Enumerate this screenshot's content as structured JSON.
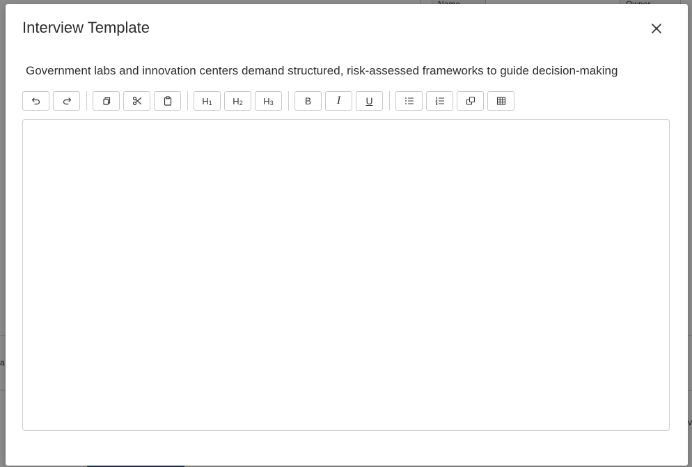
{
  "background": {
    "header_cells": [
      "Name",
      "Owner"
    ],
    "row_fragments": [
      "a",
      "vo"
    ]
  },
  "modal": {
    "title": "Interview Template",
    "description": "Government labs and innovation centers demand structured, risk-assessed frameworks to guide decision-making",
    "close_icon": "close-icon"
  },
  "toolbar": {
    "groups": [
      [
        {
          "name": "undo-button",
          "icon": "undo-icon"
        },
        {
          "name": "redo-button",
          "icon": "redo-icon"
        }
      ],
      [
        {
          "name": "copy-button",
          "icon": "copy-icon"
        },
        {
          "name": "cut-button",
          "icon": "scissors-icon"
        },
        {
          "name": "paste-button",
          "icon": "clipboard-icon"
        }
      ],
      [
        {
          "name": "heading-1-button",
          "label": "H1"
        },
        {
          "name": "heading-2-button",
          "label": "H2"
        },
        {
          "name": "heading-3-button",
          "label": "H3"
        }
      ],
      [
        {
          "name": "bold-button",
          "label": "B"
        },
        {
          "name": "italic-button",
          "label": "I"
        },
        {
          "name": "underline-button",
          "label": "U"
        }
      ],
      [
        {
          "name": "bullet-list-button",
          "icon": "bullet-list-icon"
        },
        {
          "name": "numbered-list-button",
          "icon": "numbered-list-icon"
        },
        {
          "name": "duplicate-button",
          "icon": "duplicate-icon"
        },
        {
          "name": "table-button",
          "icon": "table-icon"
        }
      ]
    ],
    "h1": "H",
    "h1_sub": "1",
    "h2": "H",
    "h2_sub": "2",
    "h3": "H",
    "h3_sub": "3",
    "bold": "B",
    "italic": "I",
    "underline": "U"
  },
  "editor": {
    "content": ""
  }
}
